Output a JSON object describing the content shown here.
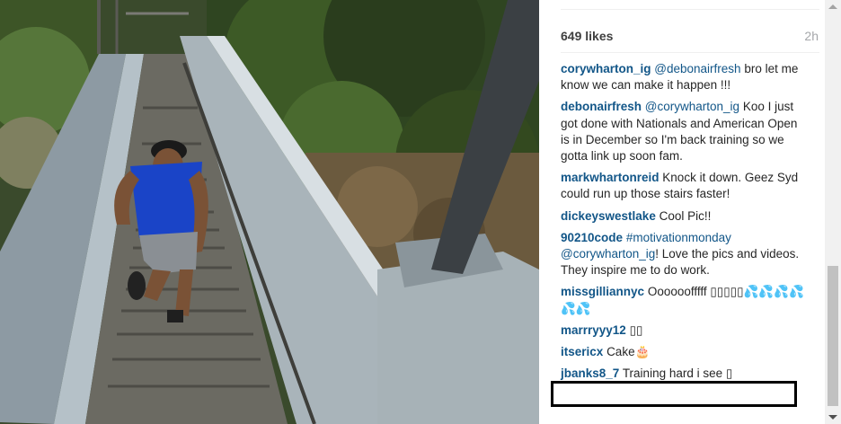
{
  "post": {
    "likes": "649 likes",
    "time": "2h"
  },
  "comments": [
    {
      "user": "corywharton_ig",
      "mention": "@debonairfresh",
      "text": " bro let me know we can make it happen !!!"
    },
    {
      "user": "debonairfresh",
      "mention": "@corywharton_ig",
      "text": " Koo I just got done with Nationals and American Open is in December so I'm back training so we gotta link up soon fam."
    },
    {
      "user": "markwhartonreid",
      "mention": "",
      "text": "Knock it down. Geez Syd could run up those stairs faster!"
    },
    {
      "user": "dickeyswestlake",
      "mention": "",
      "text": "Cool Pic!!"
    },
    {
      "user": "90210code",
      "mention": "#motivationmonday @corywharton_ig",
      "text": "! Love the pics and videos. They inspire me to do work."
    },
    {
      "user": "missgilliannyc",
      "mention": "",
      "text": "Oooooofffff ▯▯▯▯▯💦💦💦💦💦💦"
    },
    {
      "user": "marrryyy12",
      "mention": "",
      "text": "▯▯"
    },
    {
      "user": "itsericx",
      "mention": "",
      "text": "Cake🎂"
    },
    {
      "user": "jbanks8_7",
      "mention": "",
      "text": "Training hard i see ▯"
    }
  ],
  "colors": {
    "username": "#125688",
    "text": "#262626",
    "muted": "#a5a7aa",
    "highlight_border": "#000000"
  }
}
